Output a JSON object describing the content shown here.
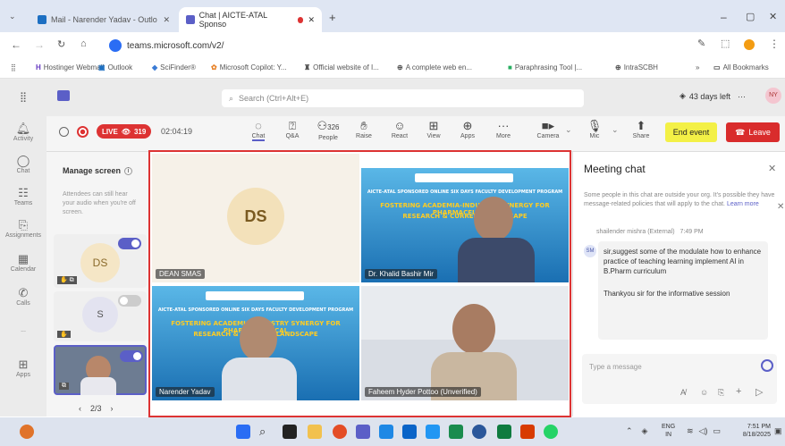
{
  "browser": {
    "tabs": [
      {
        "title": "Mail - Narender Yadav - Outlo"
      },
      {
        "title": "Chat | AICTE-ATAL Sponso"
      }
    ],
    "url": "teams.microsoft.com/v2/",
    "bookmarks": [
      "Hostinger Webmail",
      "Outlook",
      "SciFinder®",
      "Microsoft Copilot: Y...",
      "Official website of I...",
      "A complete web en...",
      "Paraphrasing Tool |...",
      "IntraSCBH"
    ],
    "all_bookmarks": "All Bookmarks"
  },
  "teams": {
    "search_placeholder": "Search (Ctrl+Alt+E)",
    "days_left": "43 days left",
    "profile_initials": "NY",
    "rail": [
      "Activity",
      "Chat",
      "Teams",
      "Assignments",
      "Calendar",
      "Calls",
      "...",
      "Apps"
    ]
  },
  "call": {
    "live_label": "LIVE",
    "viewers": "319",
    "timer": "02:04:19",
    "controls": [
      {
        "label": "Chat",
        "icon": "chat-icon"
      },
      {
        "label": "Q&A",
        "icon": "qa-icon"
      },
      {
        "label": "People",
        "icon": "people-icon",
        "count": "326"
      },
      {
        "label": "Raise",
        "icon": "hand-icon"
      },
      {
        "label": "React",
        "icon": "smile-icon"
      },
      {
        "label": "View",
        "icon": "grid-icon"
      },
      {
        "label": "Apps",
        "icon": "plus-icon"
      },
      {
        "label": "More",
        "icon": "more-icon"
      },
      {
        "label": "Camera",
        "icon": "camera-icon"
      },
      {
        "label": "Mic",
        "icon": "mic-icon"
      },
      {
        "label": "Share",
        "icon": "share-icon"
      }
    ],
    "end_event": "End event",
    "leave": "Leave"
  },
  "manage_screen": {
    "title": "Manage screen",
    "desc": "Attendees can still hear your audio when you're off screen.",
    "thumbs": [
      {
        "initials": "DS"
      },
      {
        "initials": "S"
      }
    ],
    "pager": "2/3"
  },
  "tiles": [
    {
      "name": "DEAN SMAS",
      "initials": "DS"
    },
    {
      "name": "Dr. Khalid Bashir Mir"
    },
    {
      "name": "Narender Yadav"
    },
    {
      "name": "Faheem Hyder Pottoo (Unverified)"
    }
  ],
  "banner": {
    "line1": "AICTE-ATAL SPONSORED ONLINE SIX DAYS FACULTY DEVELOPMENT PROGRAM",
    "line2": "FOSTERING ACADEMIA-INDUSTRY SYNERGY FOR PHARMACEUTICAL",
    "line3": "RESEARCH & CURRENT LANDSCAPE"
  },
  "chat": {
    "title": "Meeting chat",
    "notice": "Some people in this chat are outside your org. It's possible they have message-related policies that will apply to the chat.",
    "learn_more": "Learn more",
    "sender": "shailender mishra (External)",
    "time": "7:49 PM",
    "avatar": "SM",
    "message1": "sir,suggest some of the modulate how to enhance practice of teaching learning implement AI in B.Pharm curriculum",
    "message2": "Thankyou sir for the informative session",
    "input_placeholder": "Type a message"
  },
  "taskbar": {
    "lang": "ENG",
    "region": "IN",
    "time": "7:51 PM",
    "date": "8/18/2025"
  }
}
